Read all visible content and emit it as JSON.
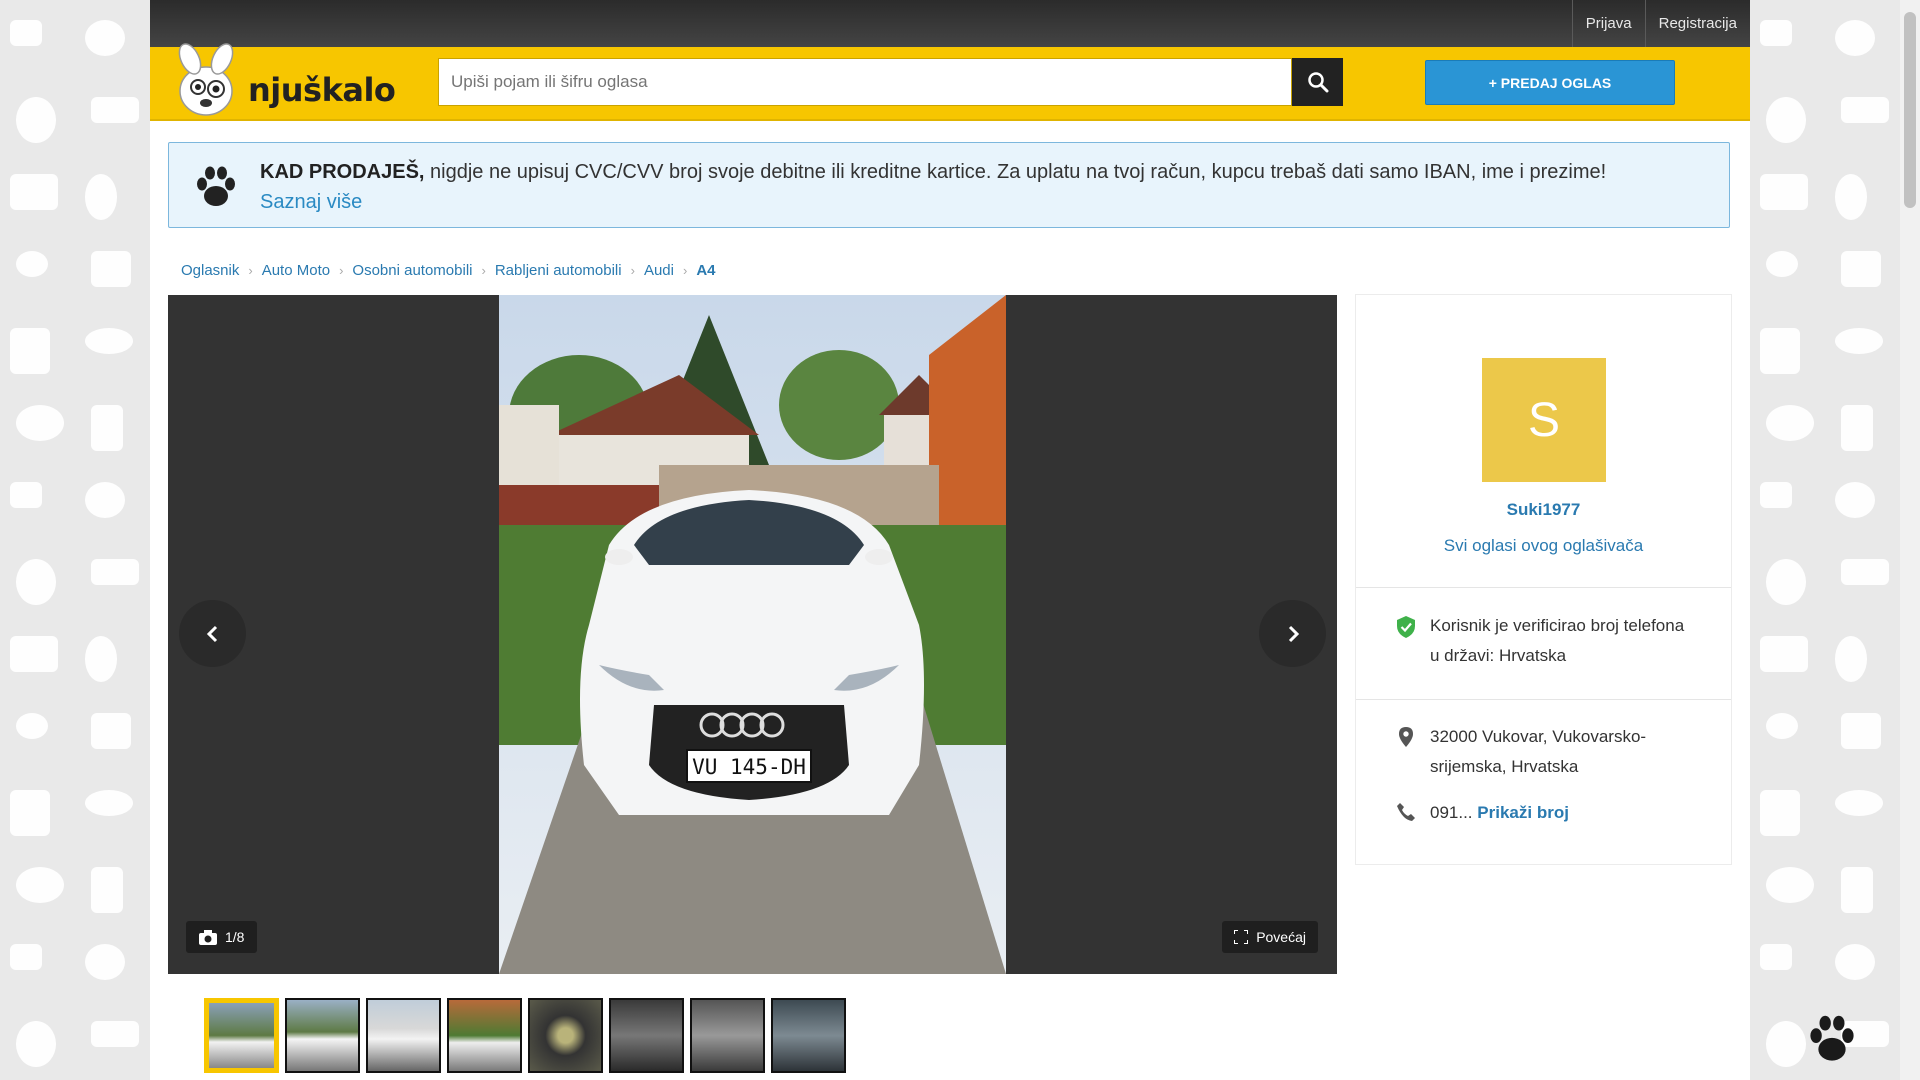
{
  "topbar": {
    "login": "Prijava",
    "register": "Registracija"
  },
  "header": {
    "logo_text": "njuškalo",
    "search_placeholder": "Upiši pojam ili šifru oglasa",
    "sell_button": "+ PREDAJ OGLAS"
  },
  "notice": {
    "bold": "KAD PRODAJEŠ,",
    "text": " nigdje ne upisuj CVC/CVV broj svoje debitne ili kreditne kartice. Za uplatu na tvoj račun, kupcu trebaš dati samo IBAN, ime i prezime!",
    "link": "Saznaj više"
  },
  "breadcrumb": [
    "Oglasnik",
    "Auto Moto",
    "Osobni automobili",
    "Rabljeni automobili",
    "Audi",
    "A4"
  ],
  "gallery": {
    "counter": "1/8",
    "enlarge": "Povećaj",
    "plate": "VU 145-DH",
    "thumbnail_count": 8
  },
  "seller": {
    "avatar_letter": "S",
    "name": "Suki1977",
    "all_ads": "Svi oglasi ovog oglašivača",
    "verified_line1": "Korisnik je verificirao broj telefona",
    "verified_line2": "u državi: Hrvatska",
    "location_line1": "32000 Vukovar, Vukovarsko-",
    "location_line2": "srijemska, Hrvatska",
    "phone_prefix": "091...",
    "phone_link": "Prikaži broj"
  },
  "colors": {
    "brand_yellow": "#f7c600",
    "link_blue": "#2a7ab0",
    "sell_blue": "#2a95d5",
    "verified_green": "#3fb14a"
  }
}
